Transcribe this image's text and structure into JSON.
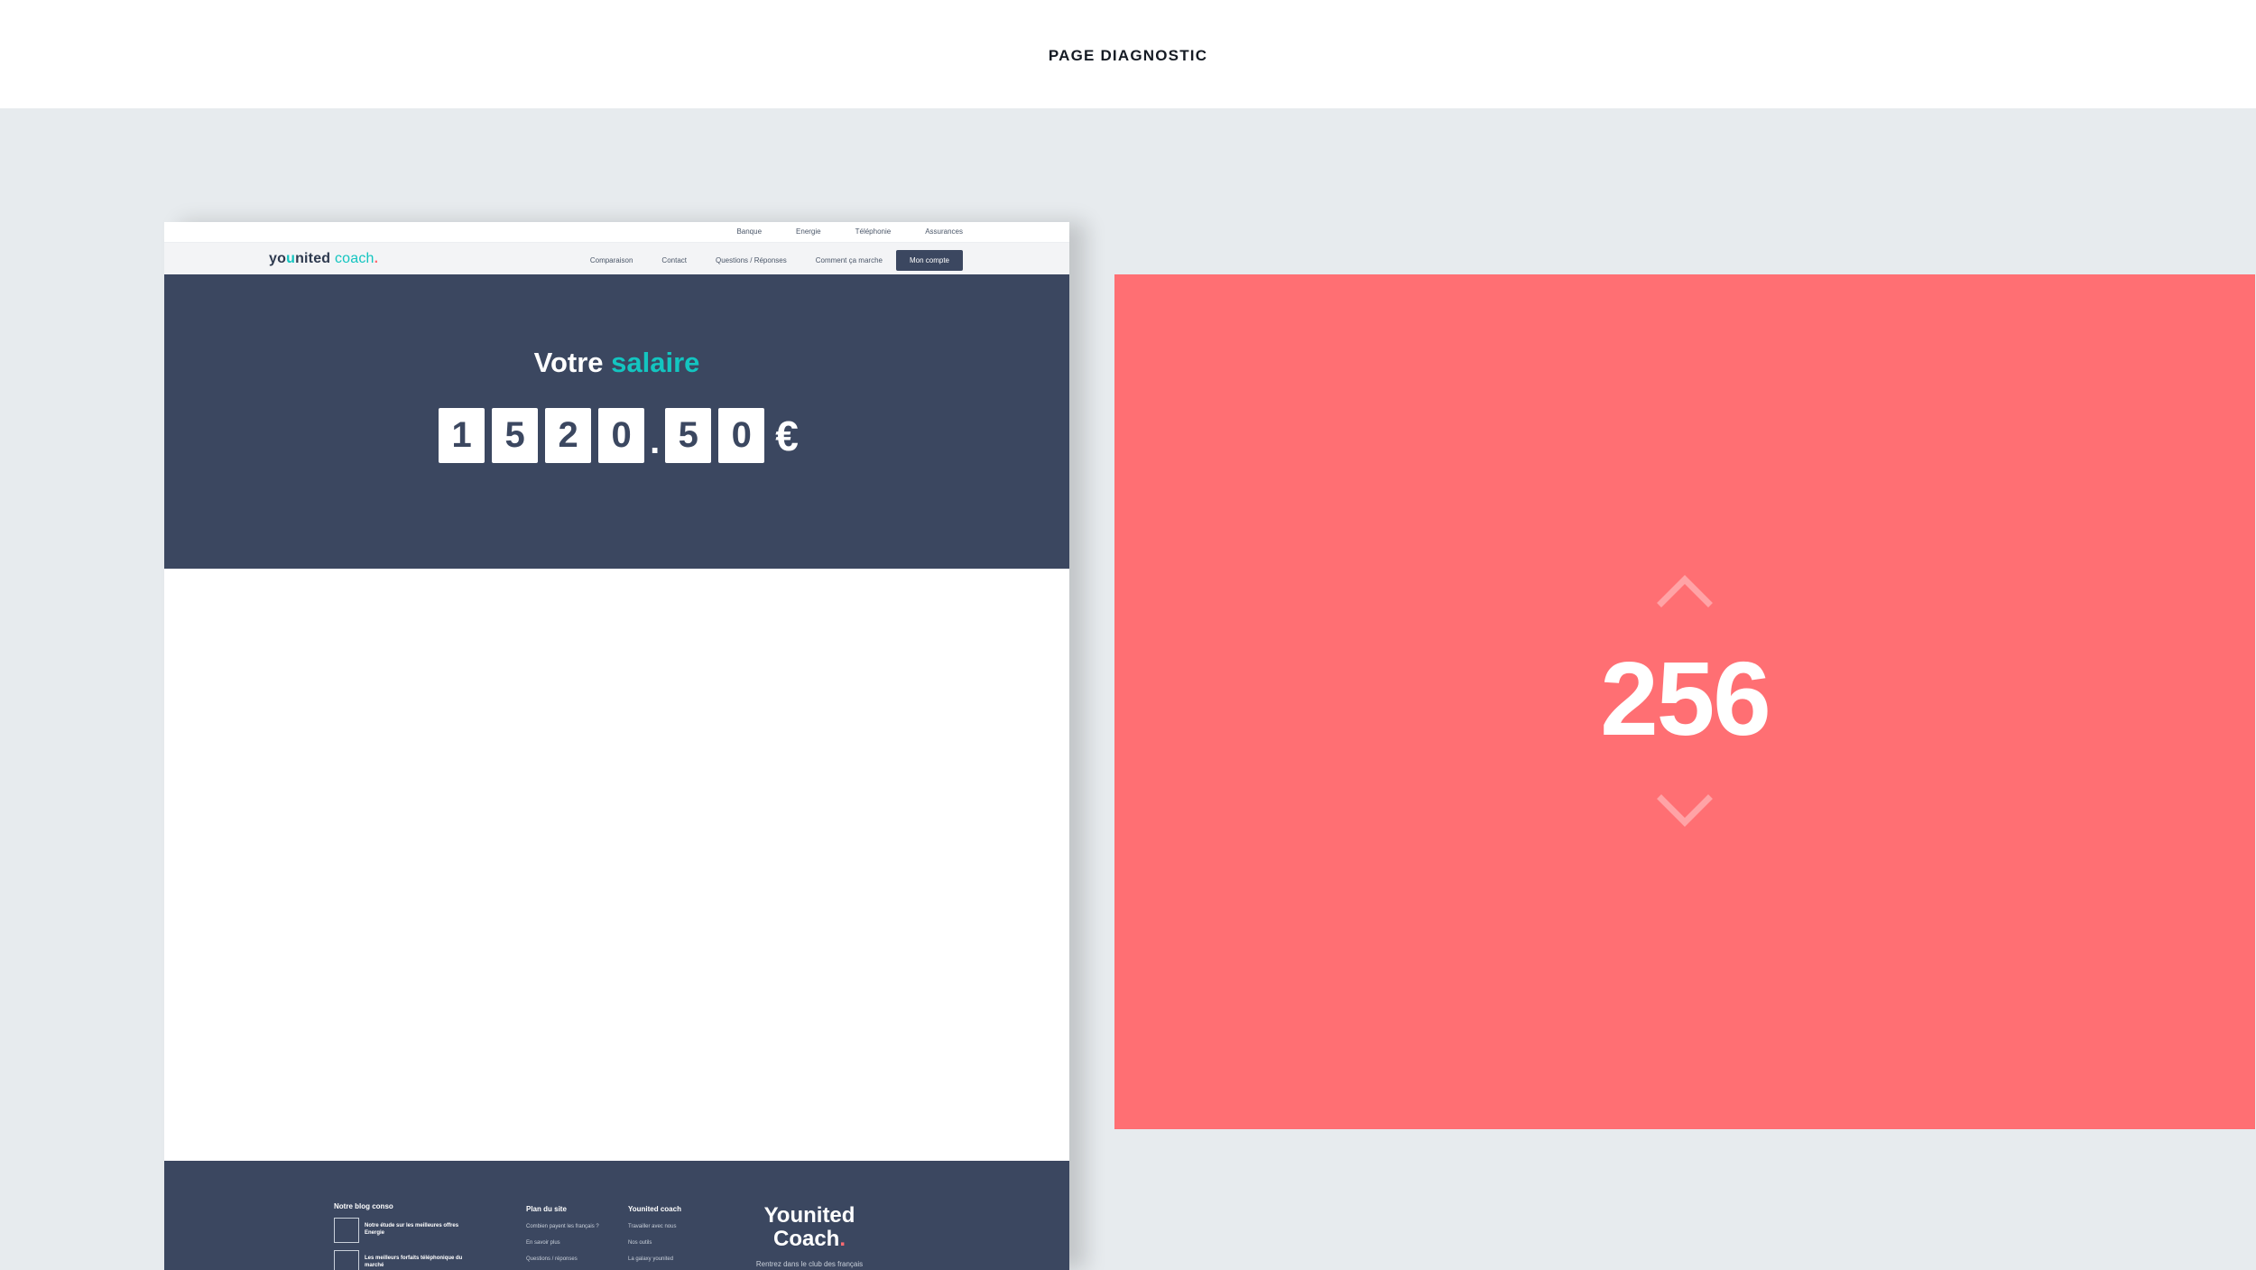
{
  "page": {
    "title": "PAGE DIAGNOSTIC"
  },
  "mockup": {
    "utility_nav": [
      "Banque",
      "Energie",
      "Téléphonie",
      "Assurances"
    ],
    "logo": {
      "part1": "yo",
      "part2": "u",
      "part3": "nited",
      "part4": "coach",
      "part5": "."
    },
    "main_nav": [
      "Comparaison",
      "Contact",
      "Questions / Réponses",
      "Comment ça marche"
    ],
    "account_button": "Mon compte",
    "hero": {
      "title_plain": "Votre ",
      "title_accent": "salaire",
      "digits": [
        "1",
        "5",
        "2",
        "0",
        ".",
        "5",
        "0"
      ],
      "currency": "€"
    },
    "footer": {
      "blog": {
        "heading": "Notre blog conso",
        "items": [
          "Notre étude sur les meilleures offres Energie",
          "Les meilleurs forfaits téléphonique du marché"
        ]
      },
      "plan": {
        "heading": "Plan du site",
        "items": [
          "Combien payent les français ?",
          "En savoir plus",
          "Questions / réponses"
        ]
      },
      "younited": {
        "heading": "Younited coach",
        "items": [
          "Travailler avec nous",
          "Nos outils",
          "La galaxy younited"
        ]
      },
      "brand": {
        "line1": "Younited",
        "line2": "Coach",
        "dot": ".",
        "tagline": "Rentrez dans le club des français"
      }
    }
  },
  "panel": {
    "counter": "256",
    "up_icon": "chevron-up-icon",
    "down_icon": "chevron-down-icon"
  },
  "colors": {
    "navy": "#3b4760",
    "teal": "#13c5c0",
    "coral": "#ff6f73",
    "background": "#e7ebee"
  }
}
